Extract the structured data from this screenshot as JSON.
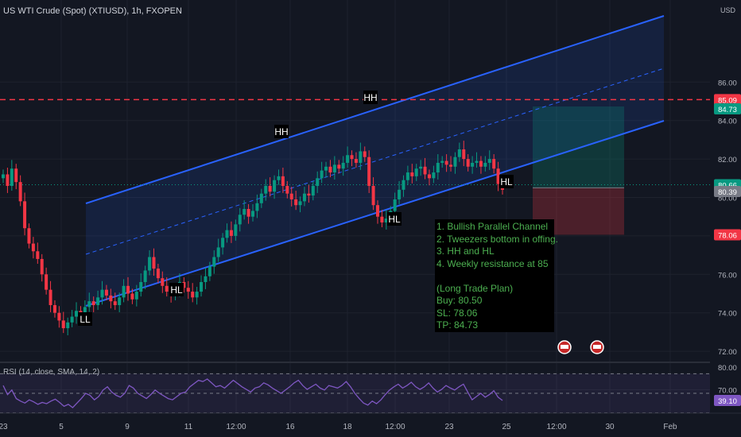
{
  "header": {
    "title": "US WTI Crude (Spot) (XTIUSD), 1h, FXOPEN",
    "currency": "USD"
  },
  "rsi": {
    "label": "RSI (14, close, SMA, 14, 2)",
    "current_value": "39.10",
    "upper": 80,
    "lower": 20,
    "axis_labels": [
      "80.00"
    ]
  },
  "chart_data": {
    "type": "candlestick",
    "y_ticks": [
      "86.00",
      "84.00",
      "82.00",
      "80.00",
      "78.00",
      "76.00",
      "74.00",
      "72.00",
      "70.00"
    ],
    "x_ticks": [
      "23",
      "5",
      "9",
      "11",
      "12:00",
      "16",
      "18",
      "12:00",
      "23",
      "25",
      "12:00",
      "30",
      "Feb"
    ],
    "ylim": [
      69.8,
      87.5
    ],
    "price_labels": [
      {
        "value": "85.09",
        "color": "#f23645"
      },
      {
        "value": "84.73",
        "color": "#089981"
      },
      {
        "value": "80.66",
        "color": "#089981"
      },
      {
        "value": "80.39",
        "color": "#787b86"
      },
      {
        "value": "78.06",
        "color": "#f23645"
      }
    ],
    "resistance_level": 85.09,
    "trade_plan": {
      "buy": 80.5,
      "sl": 78.06,
      "tp": 84.73
    },
    "annotations": [
      "LL",
      "HL",
      "HH",
      "HH",
      "HL",
      "HL"
    ],
    "close_series": [
      81.2,
      80.6,
      81.5,
      80.8,
      79.8,
      78.4,
      77.6,
      77.2,
      76.8,
      76.0,
      75.2,
      74.4,
      74.0,
      73.6,
      73.2,
      73.5,
      73.8,
      74.1,
      74.0,
      74.3,
      74.6,
      74.4,
      74.8,
      75.2,
      74.9,
      74.6,
      74.4,
      74.8,
      75.4,
      75.0,
      74.7,
      75.1,
      75.6,
      76.2,
      76.9,
      76.3,
      75.8,
      75.4,
      75.1,
      74.9,
      75.2,
      75.6,
      75.3,
      75.1,
      74.8,
      75.1,
      75.6,
      75.9,
      76.4,
      76.9,
      77.4,
      77.9,
      78.3,
      78.0,
      78.6,
      79.1,
      79.4,
      79.0,
      79.3,
      79.7,
      80.2,
      80.6,
      80.3,
      80.9,
      81.1,
      80.6,
      80.2,
      79.9,
      79.6,
      79.8,
      80.2,
      80.1,
      80.6,
      81.0,
      81.4,
      81.6,
      81.3,
      81.7,
      81.5,
      81.8,
      82.2,
      82.0,
      81.8,
      82.4,
      82.1,
      80.6,
      79.6,
      79.0,
      78.7,
      78.9,
      79.3,
      79.9,
      80.4,
      80.9,
      81.3,
      81.1,
      81.5,
      81.6,
      81.2,
      81.0,
      81.3,
      81.8,
      81.9,
      81.7,
      81.6,
      82.1,
      82.5,
      82.0,
      81.6,
      81.8,
      81.9,
      81.6,
      81.8,
      82.0,
      81.5,
      80.7,
      80.4
    ],
    "rsi_series": [
      62,
      48,
      55,
      42,
      38,
      35,
      40,
      37,
      33,
      36,
      34,
      38,
      41,
      36,
      30,
      33,
      28,
      35,
      42,
      50,
      47,
      40,
      45,
      55,
      60,
      52,
      47,
      44,
      50,
      62,
      58,
      50,
      46,
      42,
      48,
      55,
      50,
      46,
      42,
      40,
      45,
      50,
      52,
      60,
      65,
      70,
      68,
      72,
      66,
      60,
      62,
      58,
      64,
      70,
      65,
      60,
      56,
      52,
      58,
      60,
      66,
      63,
      58,
      54,
      50,
      55,
      60,
      66,
      70,
      62,
      56,
      60,
      64,
      58,
      55,
      62,
      60,
      58,
      62,
      68,
      60,
      50,
      42,
      35,
      32,
      38,
      34,
      40,
      48,
      55,
      60,
      64,
      58,
      62,
      67,
      60,
      56,
      60,
      66,
      58,
      52,
      56,
      62,
      58,
      55,
      60,
      64,
      52,
      40,
      45,
      50,
      44,
      48,
      54,
      44,
      39
    ]
  },
  "note": {
    "lines": [
      "1. Bullish Parallel Channel",
      "2. Tweezers bottom in offing.",
      "3. HH and HL",
      "4. Weekly resistance at 85",
      "",
      "(Long Trade Plan)",
      "Buy: 80.50",
      "SL: 78.06",
      "TP: 84.73"
    ]
  },
  "colors": {
    "up": "#089981",
    "down": "#f23645",
    "channel": "#2962ff",
    "rsi": "#7e57c2",
    "bg": "#131722"
  }
}
